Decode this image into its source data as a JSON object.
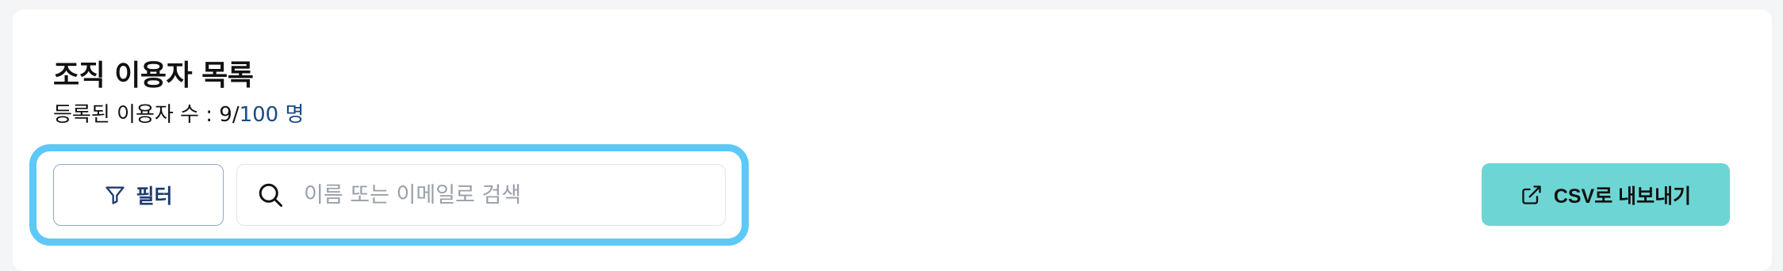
{
  "header": {
    "title": "조직 이용자 목록",
    "count_label": "등록된 이용자 수 : ",
    "count_registered": "9",
    "count_separator": "/",
    "count_total": "100 명"
  },
  "toolbar": {
    "filter_label": "필터",
    "filter_icon": "filter-funnel-icon",
    "search_icon": "search-icon",
    "search_placeholder": "이름 또는 이메일로 검색",
    "search_value": "",
    "export_label": "CSV로 내보내기",
    "export_icon": "external-link-icon"
  },
  "colors": {
    "highlight": "#5ec8f8",
    "export_button": "#6dd6d4",
    "count_total": "#1a4a85",
    "filter_text": "#1e3c6e"
  }
}
